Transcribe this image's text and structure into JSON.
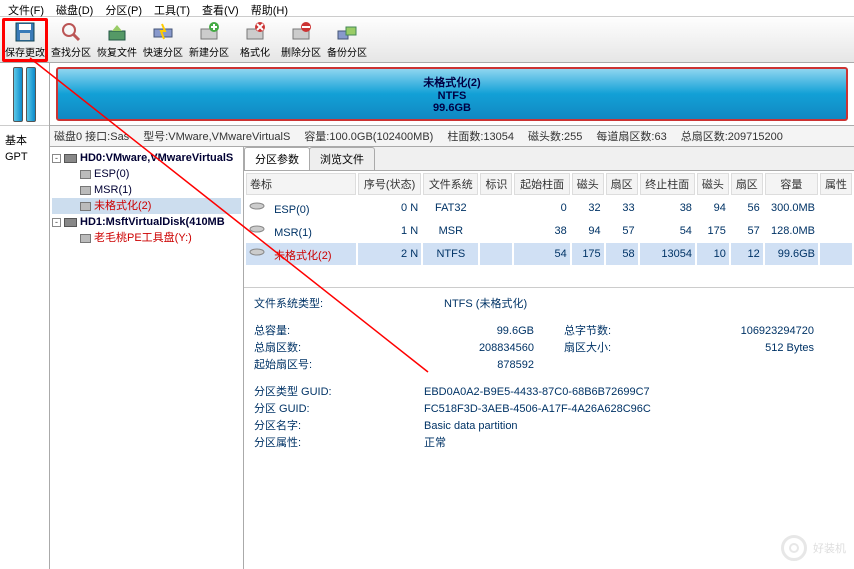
{
  "menu": {
    "file": "文件(F)",
    "disk": "磁盘(D)",
    "part": "分区(P)",
    "tool": "工具(T)",
    "view": "查看(V)",
    "help": "帮助(H)"
  },
  "toolbar": {
    "save": "保存更改",
    "find": "查找分区",
    "recover": "恢复文件",
    "quick": "快速分区",
    "new": "新建分区",
    "format": "格式化",
    "delete": "删除分区",
    "backup": "备份分区"
  },
  "left": {
    "basic": "基本",
    "gpt": "GPT"
  },
  "disk_block": {
    "l1": "未格式化(2)",
    "l2": "NTFS",
    "l3": "99.6GB"
  },
  "status": {
    "a": "磁盘0 接口:Sas",
    "b": "型号:VMware,VMwareVirtualS",
    "c": "容量:100.0GB(102400MB)",
    "d": "柱面数:13054",
    "e": "磁头数:255",
    "f": "每道扇区数:63",
    "g": "总扇区数:209715200"
  },
  "tree": {
    "d0": "HD0:VMware,VMwareVirtualS",
    "p0": "ESP(0)",
    "p1": "MSR(1)",
    "p2": "未格式化(2)",
    "d1": "HD1:MsftVirtualDisk(410MB",
    "p3": "老毛桃PE工具盘(Y:)"
  },
  "tabs": {
    "a": "分区参数",
    "b": "浏览文件"
  },
  "th": {
    "c0": "卷标",
    "c1": "序号(状态)",
    "c2": "文件系统",
    "c3": "标识",
    "c4": "起始柱面",
    "c5": "磁头",
    "c6": "扇区",
    "c7": "终止柱面",
    "c8": "磁头",
    "c9": "扇区",
    "c10": "容量",
    "c11": "属性"
  },
  "rows": [
    {
      "n": "ESP(0)",
      "s": "0 N",
      "fs": "FAT32",
      "id": "",
      "sc": "0",
      "sh": "32",
      "ss": "33",
      "ec": "38",
      "eh": "94",
      "es": "56",
      "cap": "300.0MB",
      "at": ""
    },
    {
      "n": "MSR(1)",
      "s": "1 N",
      "fs": "MSR",
      "id": "",
      "sc": "38",
      "sh": "94",
      "ss": "57",
      "ec": "54",
      "eh": "175",
      "es": "57",
      "cap": "128.0MB",
      "at": ""
    },
    {
      "n": "未格式化(2)",
      "s": "2 N",
      "fs": "NTFS",
      "id": "",
      "sc": "54",
      "sh": "175",
      "ss": "58",
      "ec": "13054",
      "eh": "10",
      "es": "12",
      "cap": "99.6GB",
      "at": ""
    }
  ],
  "info": {
    "fsk": "文件系统类型:",
    "fsv": "NTFS (未格式化)",
    "totk": "总容量:",
    "totv": "99.6GB",
    "bytek": "总字节数:",
    "bytev": "106923294720",
    "seck": "总扇区数:",
    "secv": "208834560",
    "ssk": "扇区大小:",
    "ssv": "512 Bytes",
    "startk": "起始扇区号:",
    "startv": "878592",
    "ptk": "分区类型 GUID:",
    "ptv": "EBD0A0A2-B9E5-4433-87C0-68B6B72699C7",
    "pgk": "分区 GUID:",
    "pgv": "FC518F3D-3AEB-4506-A17F-4A26A628C96C",
    "pnk": "分区名字:",
    "pnv": "Basic data partition",
    "pak": "分区属性:",
    "pav": "正常"
  },
  "watermark": "好装机"
}
